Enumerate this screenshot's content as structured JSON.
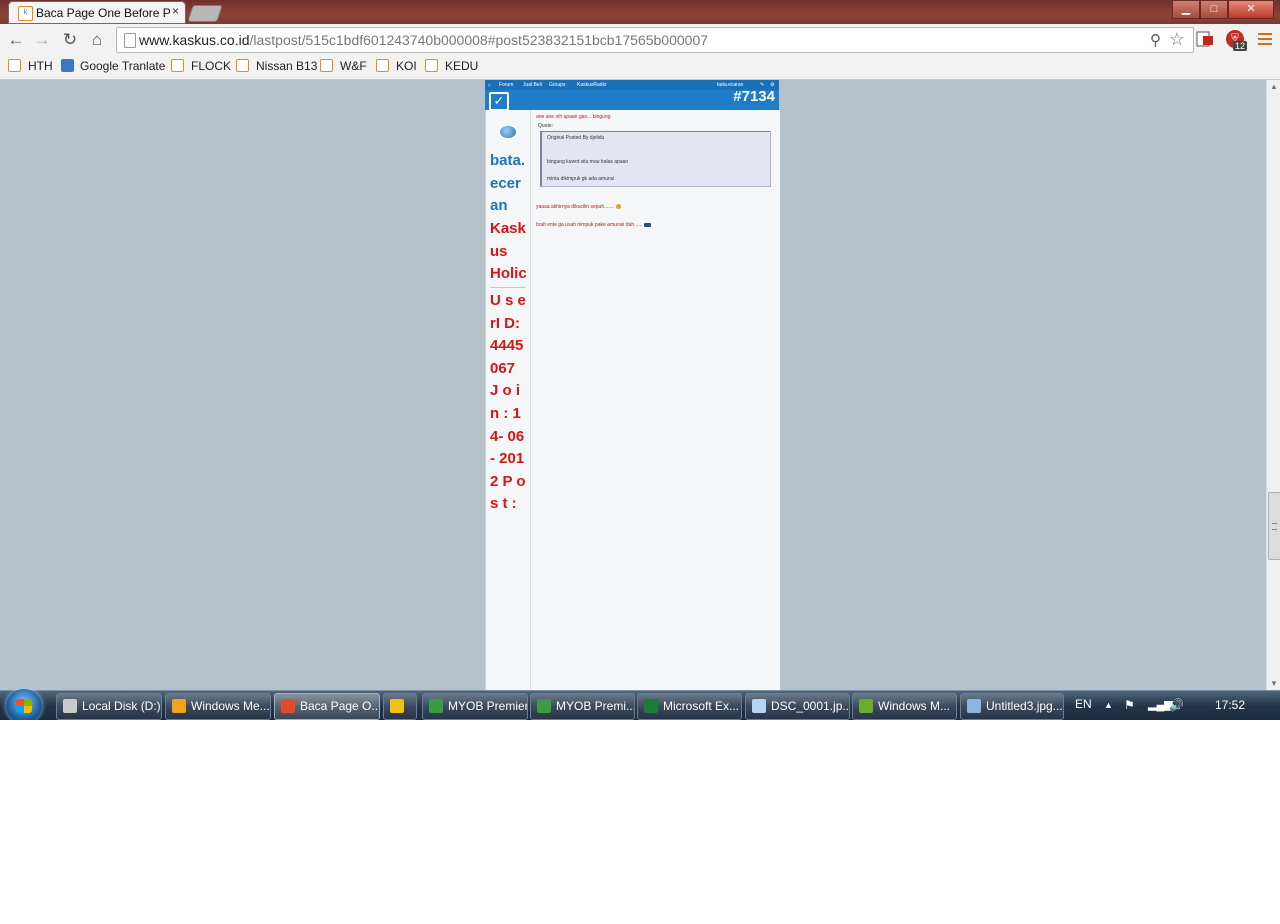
{
  "browser": {
    "tab_title": "Baca Page One Before Post",
    "tab_close": "×",
    "url_host": "www.kaskus.co.id",
    "url_path": "/lastpost/515c1bdf601243740b000008#post523832151bcb17565b000007",
    "extension_badge": "12",
    "back": "←",
    "forward": "→",
    "reload": "↻",
    "home": "⌂",
    "star": "☆",
    "search": "⚲",
    "win_min": "▁",
    "win_max": "□",
    "win_close": "✕"
  },
  "bookmarks": [
    "HTH",
    "Google Tranlate",
    "FLOCK",
    "Nissan B13",
    "W&F",
    "KOI",
    "KEDU"
  ],
  "kaskus": {
    "nav_forum": "Forum",
    "nav_jualbeli": "Jual Beli",
    "nav_groups": "Groups",
    "nav_radio": "KaskusRadio",
    "nav_user": "bata.ecaran",
    "post_number": "#7134",
    "username": "bata.ecer an",
    "user_title": "Kask us Holic",
    "user_info": "U s e rI D: 4445 067 J o i n : 14- 06- 2012 P o s t :",
    "intro_line": "ane ane nih apaan gan... bingung",
    "quote_label": "Quote:",
    "quote_author": "Original Posted By djelidu",
    "quote_line1": "bingung kuwot situ mau balas apaan",
    "quote_line2": "minta dikimpuk gk ada amunsi",
    "reply_line1": "yaaaa akhirnya dikucilin sepuh.......",
    "reply_line2": "bralt ente ga usah nimpuk pake amunisi dah......"
  },
  "taskbar": {
    "items": [
      {
        "label": "Local Disk (D:)",
        "color": "#c9c9c9"
      },
      {
        "label": "Windows Me...",
        "color": "#f2a21b"
      },
      {
        "label": "Baca Page O...",
        "color": "#e34b2c"
      },
      {
        "label": "",
        "color": "#f3c014"
      },
      {
        "label": "MYOB Premier",
        "color": "#3c9a42"
      },
      {
        "label": "MYOB Premi...",
        "color": "#3c9a42"
      },
      {
        "label": "Microsoft Ex...",
        "color": "#1e7b3c"
      },
      {
        "label": "DSC_0001.jp...",
        "color": "#b6d3f2"
      },
      {
        "label": "Windows M...",
        "color": "#6cab2c"
      },
      {
        "label": "Untitled3.jpg...",
        "color": "#8fb5de"
      }
    ],
    "lang": "EN",
    "clock": "17:52"
  }
}
